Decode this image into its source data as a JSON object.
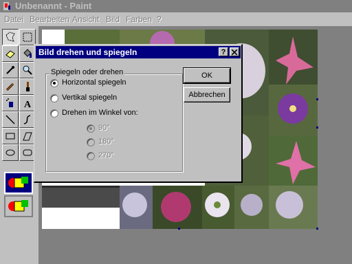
{
  "window": {
    "title": "Unbenannt - Paint"
  },
  "menu": [
    "Datei",
    "Bearbeiten",
    "Ansicht",
    "Bild",
    "Farben",
    "?"
  ],
  "tools": [
    "free-select",
    "rect-select",
    "eraser",
    "fill",
    "color-picker",
    "magnifier",
    "pencil",
    "brush",
    "airbrush",
    "text",
    "line",
    "curve",
    "rectangle",
    "polygon",
    "ellipse",
    "rounded-rect"
  ],
  "dialog": {
    "title": "Bild drehen und spiegeln",
    "help_btn": "?",
    "close_btn": "X",
    "group_label": "Spiegeln oder drehen",
    "options": [
      "Horizontal spiegeln",
      "Vertikal spiegeln",
      "Drehen im Winkel von:"
    ],
    "angles": [
      "90°",
      "180°",
      "270°"
    ],
    "ok": "OK",
    "cancel": "Abbrechen",
    "selected_option": "Horizontal spiegeln",
    "selected_angle": "90°"
  },
  "colors": {
    "title_active": "#000080",
    "face": "#c0c0c0",
    "workspace": "#808080"
  }
}
